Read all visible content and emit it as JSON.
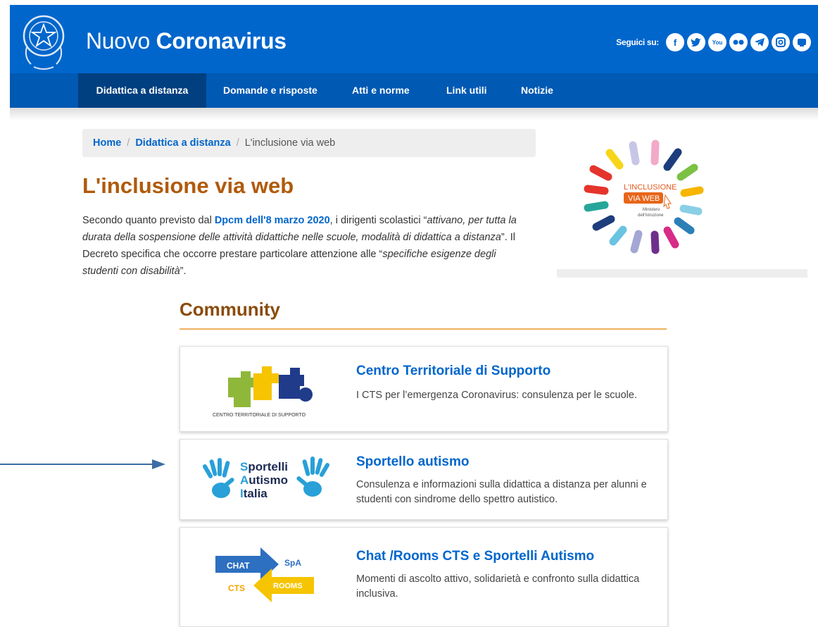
{
  "header": {
    "title_light": "Nuovo ",
    "title_bold": "Coronavirus",
    "social_label": "Seguici su:",
    "social_icons": [
      "facebook-icon",
      "twitter-icon",
      "youtube-icon",
      "flickr-icon",
      "telegram-icon",
      "instagram-icon",
      "medium-icon"
    ],
    "brand_color": "#0066cc"
  },
  "nav": {
    "items": [
      {
        "label": "Didattica a distanza",
        "active": true
      },
      {
        "label": "Domande e risposte",
        "active": false
      },
      {
        "label": "Atti e norme",
        "active": false
      },
      {
        "label": "Link utili",
        "active": false
      },
      {
        "label": "Notizie",
        "active": false
      }
    ]
  },
  "breadcrumb": {
    "home": "Home",
    "section": "Didattica a distanza",
    "current": "L'inclusione via web",
    "sep": "/"
  },
  "page": {
    "title": "L'inclusione via web",
    "intro_1": "Secondo quanto previsto dal ",
    "intro_link": "Dpcm dell'8 marzo 2020",
    "intro_2": ", i dirigenti scolastici “",
    "intro_quote_1": "attivano, per tutta la durata della sospensione delle attività didattiche nelle scuole, modalità di didattica a distanza",
    "intro_3": "”. Il Decreto specifica che occorre prestare particolare attenzione alle “",
    "intro_quote_2": "specifiche esigenze degli studenti con disabilità",
    "intro_4": "”."
  },
  "side_logo": {
    "line1": "L'INCLUSIONE",
    "line2": "VIA WEB",
    "line3": "Ministero",
    "line4": "dell'Istruzione"
  },
  "community": {
    "title": "Community",
    "cards": [
      {
        "title": "Centro Territoriale di Supporto",
        "desc": "I CTS per l’emergenza Coronavirus: consulenza per le scuole.",
        "logo_caption": "CENTRO TERRITORIALE DI SUPPORTO"
      },
      {
        "title": "Sportello autismo",
        "desc": "Consulenza e informazioni sulla didattica a distanza per alunni e studenti con sindrome dello spettro autistico.",
        "logo_s": "S",
        "logo_portelli": "portelli",
        "logo_a": "A",
        "logo_utismo": "utismo",
        "logo_i": "I",
        "logo_talia": "talia"
      },
      {
        "title": "Chat /Rooms CTS e Sportelli Autismo",
        "desc": "Momenti di ascolto attivo, solidarietà e confronto sulla didattica inclusiva.",
        "logo_chat": "CHAT",
        "logo_spa": "SpA",
        "logo_cts": "CTS",
        "logo_rooms": "ROOMS"
      }
    ]
  }
}
